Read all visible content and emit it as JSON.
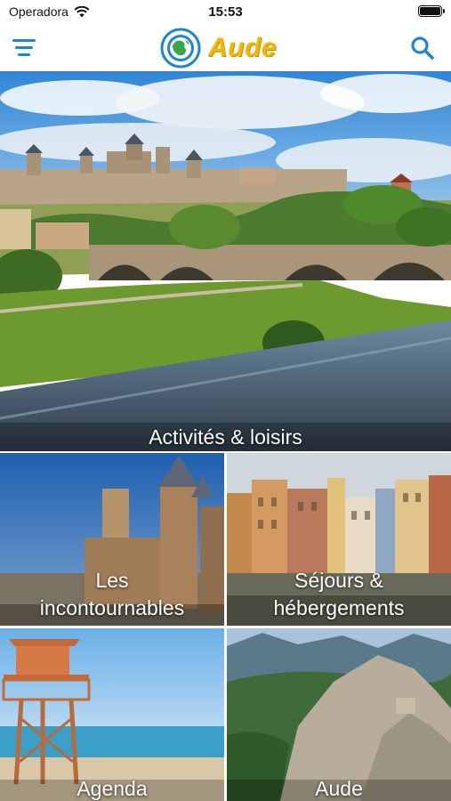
{
  "status_bar": {
    "carrier": "Operadora",
    "time": "15:53"
  },
  "header": {
    "title": "Aude",
    "menu_icon": "menu-icon",
    "search_icon": "search-icon",
    "logo_icon": "globe-logo-icon"
  },
  "tiles": [
    {
      "label": "Activités & loisirs"
    },
    {
      "label_line1": "Les",
      "label_line2": "incontournables"
    },
    {
      "label_line1": "Séjours &",
      "label_line2": "hébergements"
    },
    {
      "label": "Agenda"
    },
    {
      "label": "Aude"
    }
  ],
  "colors": {
    "accent_blue": "#1e88c8",
    "brand_yellow": "#f2b705"
  }
}
